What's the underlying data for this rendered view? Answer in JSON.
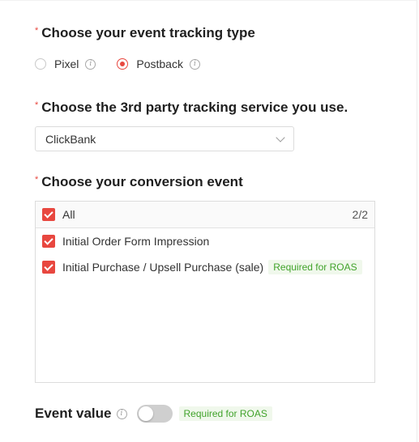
{
  "tracking_type": {
    "title": "Choose your event tracking type",
    "options": [
      {
        "label": "Pixel",
        "selected": false,
        "icon": "info-icon"
      },
      {
        "label": "Postback",
        "selected": true,
        "icon": "info-icon"
      }
    ]
  },
  "tracking_service": {
    "title": "Choose the 3rd party tracking service you use.",
    "selected_value": "ClickBank",
    "icon": "chevron-down-icon"
  },
  "conversion_event": {
    "title": "Choose your conversion event",
    "all_label": "All",
    "count": "2/2",
    "items": [
      {
        "label": "Initial Order Form Impression",
        "checked": true,
        "tag": ""
      },
      {
        "label": "Initial Purchase / Upsell Purchase (sale)",
        "checked": true,
        "tag": "Required for ROAS"
      }
    ]
  },
  "event_value": {
    "title": "Event value",
    "toggle_on": false,
    "tag": "Required for ROAS"
  },
  "colors": {
    "accent": "#e8473f",
    "tag_text": "#41a32b",
    "tag_bg": "#f0f8ec"
  }
}
